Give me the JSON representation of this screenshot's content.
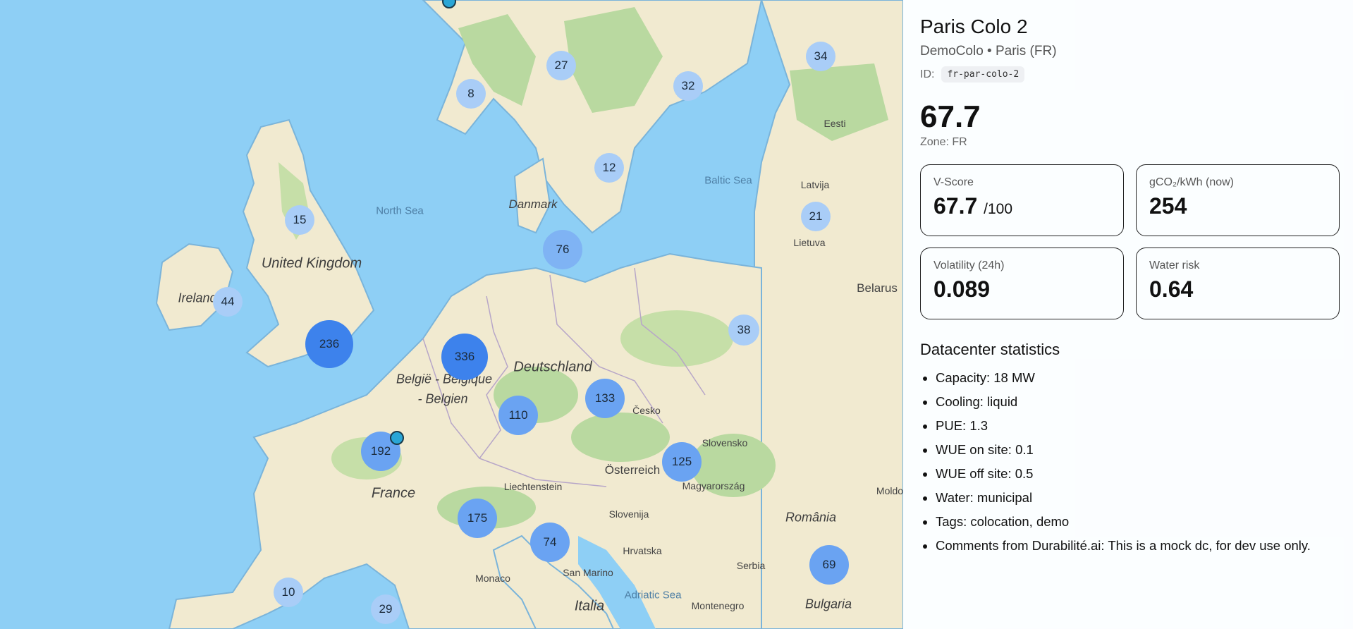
{
  "map": {
    "labels": {
      "north_sea": "North Sea",
      "baltic_sea": "Baltic Sea",
      "united_kingdom": "United Kingdom",
      "ireland": "Ireland",
      "danmark": "Danmark",
      "deutschland": "Deutschland",
      "belgie": "België - Belgique",
      "belgien": "- Belgien",
      "france": "France",
      "cesko": "Česko",
      "slovensko": "Slovensko",
      "osterreich": "Österreich",
      "liechtenstein": "Liechtenstein",
      "magyarorszag": "Magyarország",
      "slovenija": "Slovenija",
      "hrvatska": "Hrvatska",
      "monaco": "Monaco",
      "san_marino": "San Marino",
      "italia": "Italia",
      "adriatic_sea": "Adriatic Sea",
      "montenegro": "Montenegro",
      "serbia": "Serbia",
      "romania": "România",
      "bulgaria": "Bulgaria",
      "latvija": "Latvija",
      "lietuva": "Lietuva",
      "eesti": "Eesti",
      "belarus": "Belarus",
      "moldova": "Moldo"
    },
    "clusters": [
      {
        "count": "27"
      },
      {
        "count": "8"
      },
      {
        "count": "32"
      },
      {
        "count": "34"
      },
      {
        "count": "12"
      },
      {
        "count": "15"
      },
      {
        "count": "21"
      },
      {
        "count": "76"
      },
      {
        "count": "44"
      },
      {
        "count": "236"
      },
      {
        "count": "336"
      },
      {
        "count": "38"
      },
      {
        "count": "133"
      },
      {
        "count": "110"
      },
      {
        "count": "192"
      },
      {
        "count": "125"
      },
      {
        "count": "175"
      },
      {
        "count": "74"
      },
      {
        "count": "69"
      },
      {
        "count": "10"
      },
      {
        "count": "29"
      }
    ]
  },
  "panel": {
    "title": "Paris Colo 2",
    "subtitle": "DemoColo • Paris (FR)",
    "id_label": "ID:",
    "id_value": "fr-par-colo-2",
    "score": "67.7",
    "zone": "Zone: FR",
    "cards": {
      "vscore_label": "V-Score",
      "vscore_value": "67.7",
      "vscore_unit": "/100",
      "gco2_label": "gCO₂/kWh (now)",
      "gco2_value": "254",
      "volatility_label": "Volatility (24h)",
      "volatility_value": "0.089",
      "water_label": "Water risk",
      "water_value": "0.64"
    },
    "stats_title": "Datacenter statistics",
    "stats": [
      "Capacity: 18 MW",
      "Cooling: liquid",
      "PUE: 1.3",
      "WUE on site: 0.1",
      "WUE off site: 0.5",
      "Water: municipal",
      "Tags: colocation, demo",
      "Comments from Durabilité.ai: This is a mock dc, for dev use only."
    ]
  },
  "colors": {
    "sea": "#8ecff5",
    "land": "#f1ead0",
    "forest": "#b9d9a0",
    "cluster_small": "#a9cdf7",
    "cluster_mid": "#7fb3f4",
    "cluster_large": "#3d82ec"
  }
}
